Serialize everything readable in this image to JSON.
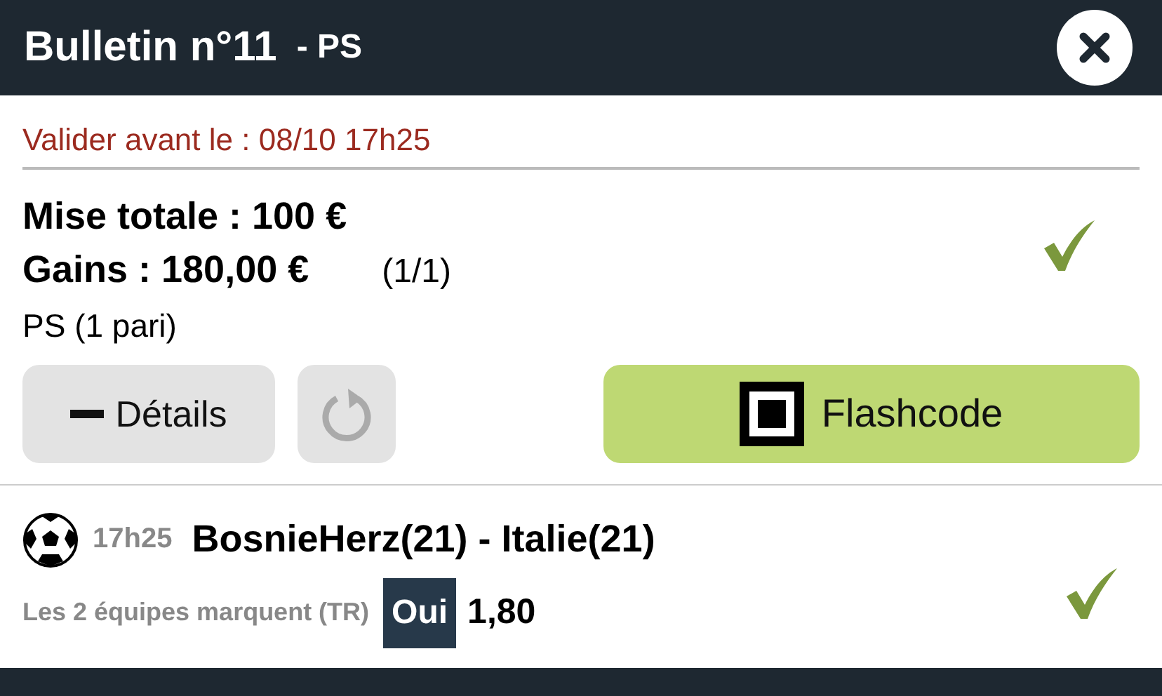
{
  "header": {
    "title": "Bulletin n°11",
    "subtitle": "- PS"
  },
  "deadline": "Valider avant le : 08/10 17h25",
  "summary": {
    "stake": "Mise totale : 100 €",
    "winnings": "Gains : 180,00 €",
    "count": "(1/1)",
    "type": "PS (1 pari)"
  },
  "buttons": {
    "details": {
      "label": "Détails",
      "expanded": true
    },
    "flashcode": {
      "label": "Flashcode"
    }
  },
  "bets": [
    {
      "time": "17h25",
      "match": "BosnieHerz(21) - Italie(21)",
      "market": "Les 2 équipes marquent (TR)",
      "choice": "Oui",
      "odds": "1,80"
    }
  ]
}
